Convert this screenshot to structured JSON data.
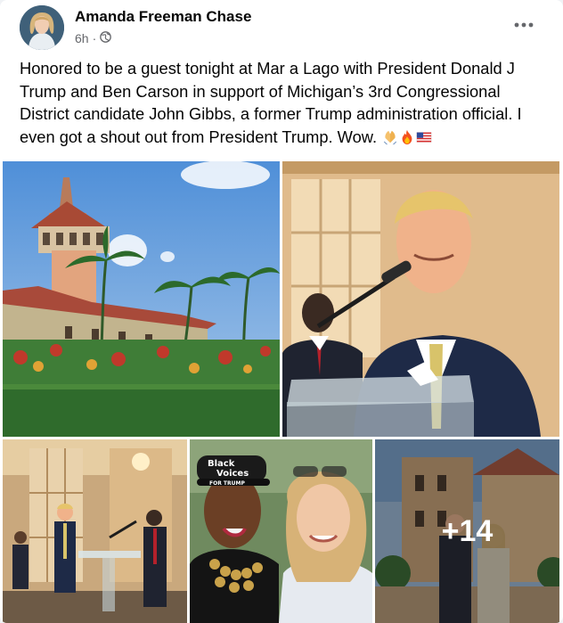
{
  "post": {
    "author": "Amanda Freeman Chase",
    "time": "6h",
    "meta_separator": "·",
    "privacy_icon": "globe-icon",
    "more_icon": "ellipsis-icon",
    "caption": "Honored to be a guest tonight at Mar a Lago with President Donald J Trump and Ben Carson in support of Michigan’s 3rd Congressional District candidate John Gibbs, a former Trump administration official.  I even got a shout out from President Trump.  Wow.",
    "emojis": [
      "folded-hands-emoji",
      "fire-emoji",
      "us-flag-emoji"
    ]
  },
  "gallery": {
    "photos": [
      {
        "name": "mar-a-lago-tower-photo"
      },
      {
        "name": "trump-at-podium-photo"
      },
      {
        "name": "ballroom-speech-photo"
      },
      {
        "name": "two-women-selfie-photo",
        "hat_text_1": "Black",
        "hat_text_2": "Voices",
        "hat_text_3": "FOR TRUMP"
      },
      {
        "name": "more-photos-tile",
        "overlay": "+14"
      }
    ]
  },
  "colors": {
    "name": "#050505",
    "secondary_text": "#65676b",
    "background": "#ffffff"
  }
}
